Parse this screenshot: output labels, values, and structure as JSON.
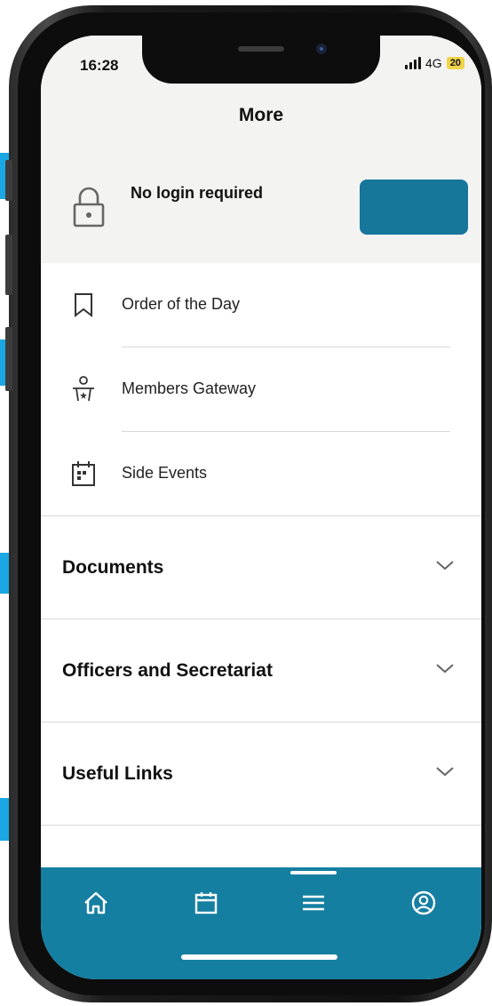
{
  "status_bar": {
    "time": "16:28",
    "network": "4G",
    "battery": "20",
    "battery_color": "#f1d34a"
  },
  "header": {
    "title": "More"
  },
  "login": {
    "text": "No login required",
    "icon": "lock-icon",
    "button_color": "#17779b"
  },
  "menu": {
    "items": [
      {
        "label": "Order of the Day",
        "icon": "bookmark-icon"
      },
      {
        "label": "Members Gateway",
        "icon": "speaker-podium-icon"
      },
      {
        "label": "Side Events",
        "icon": "calendar-grid-icon"
      }
    ]
  },
  "sections": [
    {
      "label": "Documents",
      "icon": "chevron-down-icon"
    },
    {
      "label": "Officers and Secretariat",
      "icon": "chevron-down-icon"
    },
    {
      "label": "Useful Links",
      "icon": "chevron-down-icon"
    }
  ],
  "tabbar": {
    "color": "#157fa1",
    "tabs": [
      {
        "name": "home",
        "icon": "home-icon"
      },
      {
        "name": "calendar",
        "icon": "calendar-icon"
      },
      {
        "name": "more",
        "icon": "menu-icon",
        "active": true
      },
      {
        "name": "profile",
        "icon": "user-circle-icon"
      }
    ]
  }
}
